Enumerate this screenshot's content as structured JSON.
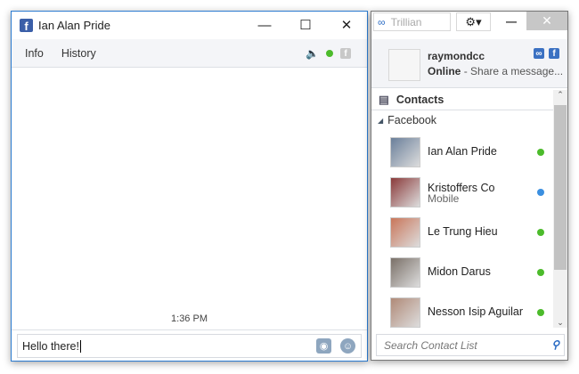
{
  "chat": {
    "title": "Ian Alan Pride",
    "menu": [
      "Info",
      "History"
    ],
    "timestamp": "1:36 PM",
    "input_value": "Hello there!"
  },
  "trillian": {
    "search_label": "Trillian",
    "username": "raymondcc",
    "status": "Online",
    "status_message": "- Share a message...",
    "contacts_label": "Contacts",
    "group": "Facebook",
    "contacts": [
      {
        "name": "Ian Alan Pride",
        "sub": "",
        "status_color": "#4cbb2b",
        "pic": "#6a7f9a"
      },
      {
        "name": "Kristoffers Co",
        "sub": "Mobile",
        "status_color": "#3b8fe0",
        "pic": "#8a3a3a"
      },
      {
        "name": "Le Trung Hieu",
        "sub": "",
        "status_color": "#4cbb2b",
        "pic": "#c9765a"
      },
      {
        "name": "Midon Darus",
        "sub": "",
        "status_color": "#4cbb2b",
        "pic": "#7a7068"
      },
      {
        "name": "Nesson Isip Aguilar",
        "sub": "",
        "status_color": "#4cbb2b",
        "pic": "#b08a78"
      }
    ],
    "search_placeholder": "Search Contact List"
  }
}
